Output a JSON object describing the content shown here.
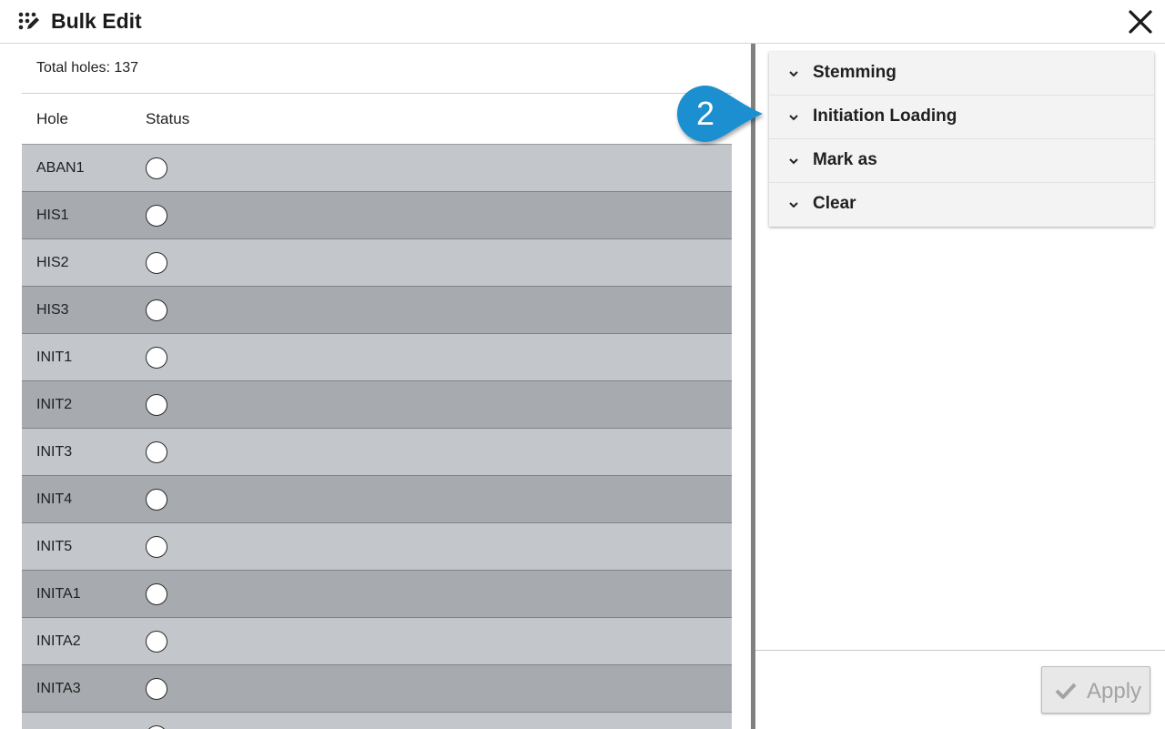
{
  "header": {
    "title": "Bulk Edit",
    "app_icon": "dots-pencil-icon",
    "close_icon": "close-icon"
  },
  "left": {
    "total_label": "Total holes: 137",
    "columns": [
      "Hole",
      "Status"
    ],
    "rows": [
      {
        "hole": "ABAN1",
        "status": "empty"
      },
      {
        "hole": "HIS1",
        "status": "empty"
      },
      {
        "hole": "HIS2",
        "status": "empty"
      },
      {
        "hole": "HIS3",
        "status": "empty"
      },
      {
        "hole": "INIT1",
        "status": "empty"
      },
      {
        "hole": "INIT2",
        "status": "empty"
      },
      {
        "hole": "INIT3",
        "status": "empty"
      },
      {
        "hole": "INIT4",
        "status": "empty"
      },
      {
        "hole": "INIT5",
        "status": "empty"
      },
      {
        "hole": "INITA1",
        "status": "empty"
      },
      {
        "hole": "INITA2",
        "status": "empty"
      },
      {
        "hole": "INITA3",
        "status": "empty"
      },
      {
        "hole": "",
        "status": "empty"
      }
    ]
  },
  "right": {
    "sections": [
      {
        "label": "Stemming",
        "icon": "chevron-down-icon"
      },
      {
        "label": "Initiation Loading",
        "icon": "chevron-down-icon"
      },
      {
        "label": "Mark as",
        "icon": "chevron-down-icon"
      },
      {
        "label": "Clear",
        "icon": "chevron-down-icon"
      }
    ],
    "callout_number": "2",
    "apply_label": "Apply",
    "apply_icon": "check-icon"
  },
  "colors": {
    "row_light": "#c3c6ca",
    "row_dark": "#a7aaae",
    "callout": "#1b8fd0",
    "accordion_bg": "#f3f3f3",
    "apply_text_disabled": "#a3a3a3"
  }
}
